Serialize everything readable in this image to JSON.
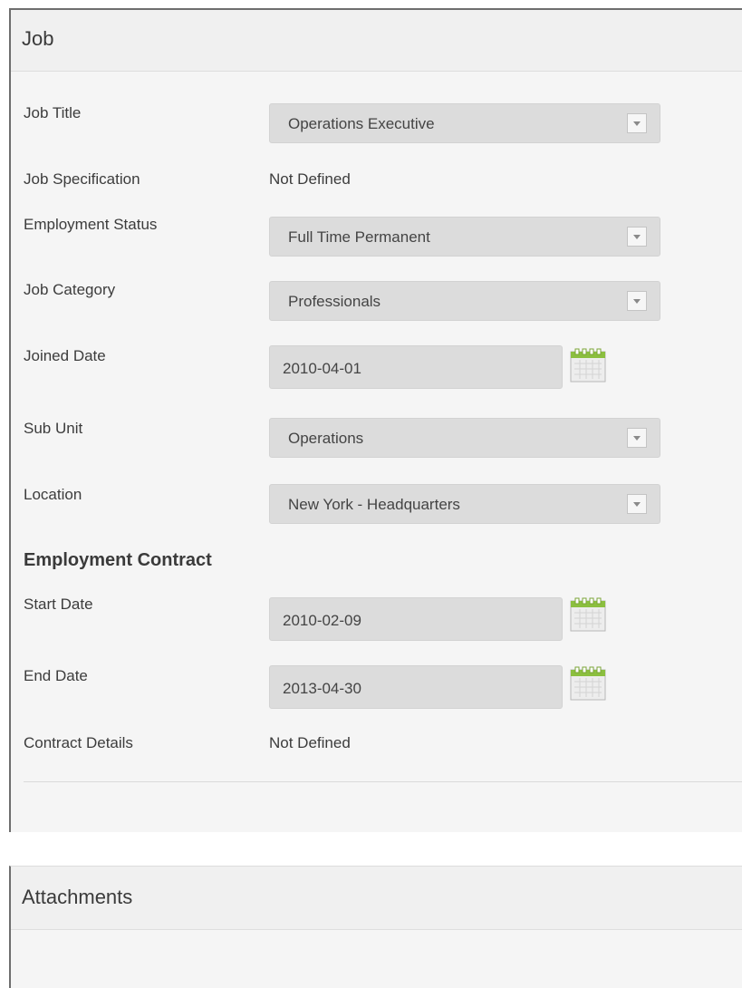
{
  "job": {
    "title": "Job",
    "fields": {
      "job_title": {
        "label": "Job Title",
        "value": "Operations Executive"
      },
      "job_specification": {
        "label": "Job Specification",
        "value": "Not Defined"
      },
      "employment_status": {
        "label": "Employment Status",
        "value": "Full Time Permanent"
      },
      "job_category": {
        "label": "Job Category",
        "value": "Professionals"
      },
      "joined_date": {
        "label": "Joined Date",
        "value": "2010-04-01"
      },
      "sub_unit": {
        "label": "Sub Unit",
        "value": "Operations"
      },
      "location": {
        "label": "Location",
        "value": "New York - Headquarters"
      }
    },
    "contract": {
      "title": "Employment Contract",
      "start_date": {
        "label": "Start Date",
        "value": "2010-02-09"
      },
      "end_date": {
        "label": "End Date",
        "value": "2013-04-30"
      },
      "contract_details": {
        "label": "Contract Details",
        "value": "Not Defined"
      }
    }
  },
  "attachments": {
    "title": "Attachments"
  },
  "icons": {
    "calendar": "calendar-icon",
    "dropdown": "chevron-down-icon"
  },
  "colors": {
    "panel_bg": "#f5f5f5",
    "input_bg": "#dcdcdc",
    "calendar_green": "#8bbf3f"
  }
}
